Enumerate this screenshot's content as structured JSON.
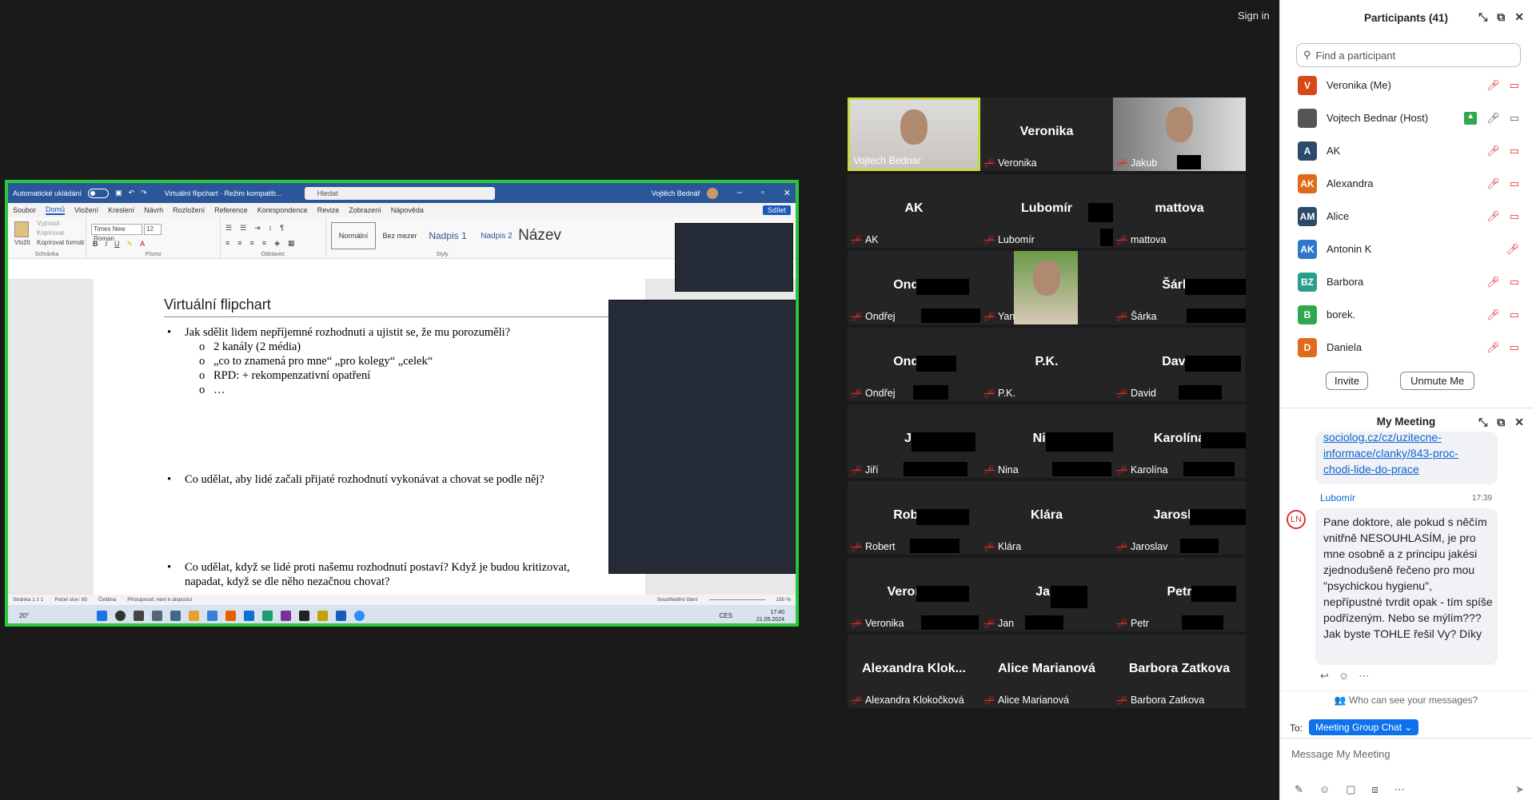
{
  "signin": "Sign in",
  "word": {
    "autosave": "Automatické ukládání",
    "doc_title": "Virtuální flipchart · Režim kompatib...",
    "search": "Hledat",
    "user": "Vojtěch Bednář",
    "menu": [
      "Soubor",
      "Domů",
      "Vložení",
      "Kreslení",
      "Návrh",
      "Rozložení",
      "Reference",
      "Korespondence",
      "Revize",
      "Zobrazení",
      "Nápověda"
    ],
    "share_btn": "Sdílet",
    "clipboard": [
      "Vyjmout",
      "Kopírovat",
      "Kopírovat formát"
    ],
    "paste": "Vložit",
    "font": "Times New Roman",
    "size": "12",
    "groups": [
      "Schránka",
      "Písmo",
      "Odstavec",
      "Styly"
    ],
    "styles": [
      "Normální",
      "Bez mezer",
      "Nadpis 1",
      "Nadpis 2",
      "Název"
    ],
    "heading": "Virtuální flipchart",
    "b1": "Jak sdělit lidem nepříjemné rozhodnuti a ujistit se, že mu porozuměli?",
    "s1": "2 kanály (2 média)",
    "s2": "„co to znamená pro mne“ „pro kolegy“ „celek“",
    "s3": "RPD: + rekompenzativní opatření",
    "s4": "…",
    "b2": "Co udělat, aby lidé začali přijaté rozhodnutí vykonávat a chovat se podle něj?",
    "b3a": "Co udělat, když se lidé proti našemu rozhodnutí postaví? Když je budou kritizovat,",
    "b3b": "napadat, když se dle něho nezačnou chovat?",
    "status": [
      "Stránka 1 z 1",
      "Počet slov: 85",
      "Čeština",
      "Přístupnost: není k dispozici",
      "Soustředění čtení",
      "150 %"
    ],
    "weather": "20°",
    "lang": "CES",
    "time": "17:40",
    "date": "21.05.2024"
  },
  "tiles": [
    {
      "name": "",
      "label": "Vojtech Bednar",
      "video": true
    },
    {
      "name": "Veronika",
      "label": "Veronika"
    },
    {
      "name": "",
      "label": "Jakub",
      "video": true
    },
    {
      "name": "AK",
      "label": "AK"
    },
    {
      "name": "Lubomír",
      "label": "Lubomír"
    },
    {
      "name": "mattova",
      "label": "mattova"
    },
    {
      "name": "Ondřej",
      "label": "Ondřej"
    },
    {
      "name": "",
      "label": "Yan",
      "video": true
    },
    {
      "name": "Šárka",
      "label": "Šárka"
    },
    {
      "name": "Ondřej",
      "label": "Ondřej"
    },
    {
      "name": "P.K.",
      "label": "P.K."
    },
    {
      "name": "David",
      "label": "David"
    },
    {
      "name": "Jiří",
      "label": "Jiří"
    },
    {
      "name": "Nina",
      "label": "Nina"
    },
    {
      "name": "Karolína",
      "label": "Karolína"
    },
    {
      "name": "Robert",
      "label": "Robert"
    },
    {
      "name": "Klára",
      "label": "Klára"
    },
    {
      "name": "Jaroslav",
      "label": "Jaroslav"
    },
    {
      "name": "Veronika",
      "label": "Veronika"
    },
    {
      "name": "Jan",
      "label": "Jan"
    },
    {
      "name": "Petr",
      "label": "Petr"
    },
    {
      "name": "Alexandra  Klok...",
      "label": "Alexandra Klokočková"
    },
    {
      "name": "Alice Marianová",
      "label": "Alice Marianová"
    },
    {
      "name": "Barbora Zatkova",
      "label": "Barbora Zatkova"
    }
  ],
  "participants": {
    "title": "Participants (41)",
    "search_placeholder": "Find a participant",
    "list": [
      {
        "initials": "V",
        "name": "Veronika (Me)",
        "color": "#d9481a"
      },
      {
        "initials": "",
        "name": "Vojtech Bednar (Host)",
        "color": "#555"
      },
      {
        "initials": "A",
        "name": "AK",
        "color": "#2d4a6b"
      },
      {
        "initials": "AK",
        "name": "Alexandra",
        "color": "#e06a1b"
      },
      {
        "initials": "AM",
        "name": "Alice",
        "color": "#2d4a6b"
      },
      {
        "initials": "AK",
        "name": "Antonin K",
        "color": "#2e78c7"
      },
      {
        "initials": "BZ",
        "name": "Barbora",
        "color": "#2a9d8f"
      },
      {
        "initials": "B",
        "name": "borek.",
        "color": "#2fa84f"
      },
      {
        "initials": "D",
        "name": "Daniela",
        "color": "#e06a1b"
      }
    ],
    "invite": "Invite",
    "unmute": "Unmute Me"
  },
  "chat": {
    "title": "My Meeting",
    "link_text": "sociolog.cz/cz/uzitecne-informace/clanky/843-proc-chodi-lide-do-prace",
    "sender": "Lubomír",
    "sender_initials": "LN",
    "time": "17:39",
    "message": "Pane doktore, ale pokud s něčím vnitřně NESOUHLASÍM, je pro mne osobně a z principu jakési zjednodušeně řečeno pro mou \"psychickou hygienu\", nepřípustné tvrdit opak - tím spíše podřízeným. Nebo se mýlím??? Jak byste TOHLE řešil Vy? Díky",
    "who_can_see": "Who can see your messages?",
    "to_label": "To:",
    "to_value": "Meeting Group Chat",
    "placeholder": "Message My Meeting"
  }
}
